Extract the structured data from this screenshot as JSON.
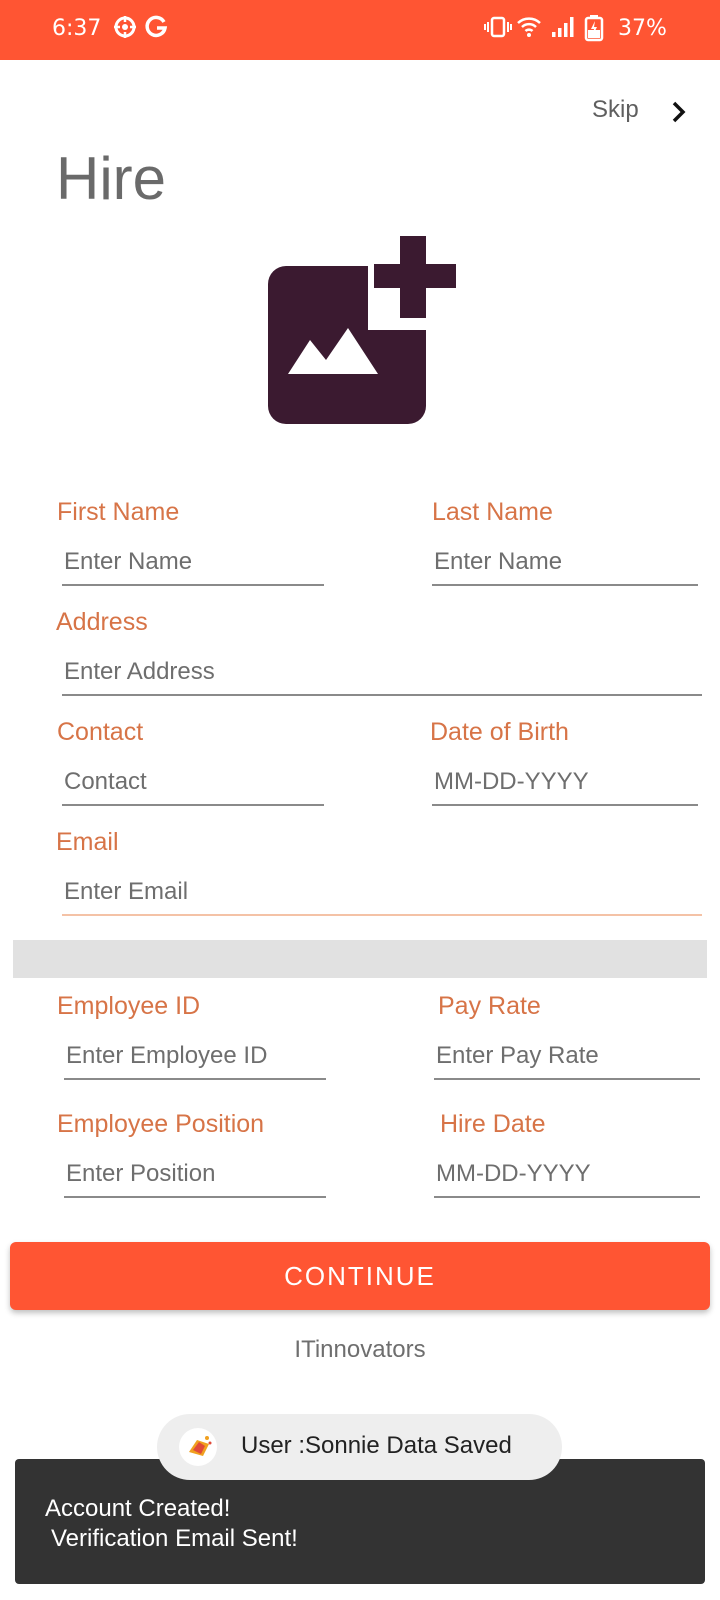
{
  "status_bar": {
    "time": "6:37",
    "battery": "37%",
    "icons": [
      "sync-icon",
      "google-icon",
      "vibrate-icon",
      "wifi-icon",
      "signal-icon",
      "battery-icon"
    ]
  },
  "header": {
    "skip_label": "Skip",
    "title": "Hire"
  },
  "photo": {
    "icon": "add-photo-icon",
    "color": "#3b1a30"
  },
  "form": {
    "first_name": {
      "label": "First Name",
      "placeholder": "Enter Name"
    },
    "last_name": {
      "label": "Last Name",
      "placeholder": "Enter Name"
    },
    "address": {
      "label": "Address",
      "placeholder": "Enter Address"
    },
    "contact": {
      "label": "Contact",
      "placeholder": "Contact"
    },
    "dob": {
      "label": "Date of Birth",
      "placeholder": "MM-DD-YYYY"
    },
    "email": {
      "label": "Email",
      "placeholder": "Enter Email"
    },
    "employee_id": {
      "label": "Employee ID",
      "placeholder": "Enter Employee ID"
    },
    "pay_rate": {
      "label": "Pay Rate",
      "placeholder": "Enter Pay Rate"
    },
    "position": {
      "label": "Employee Position",
      "placeholder": "Enter Position"
    },
    "hire_date": {
      "label": "Hire Date",
      "placeholder": "MM-DD-YYYY"
    }
  },
  "actions": {
    "continue_label": "CONTINUE"
  },
  "footer": {
    "brand": "ITinnovators"
  },
  "toast": {
    "text": "User :Sonnie Data Saved"
  },
  "snackbar": {
    "line1": "Account Created!",
    "line2": "Verification Email Sent!"
  },
  "colors": {
    "accent": "#ff5533",
    "label": "#d77447",
    "icon": "#3b1a30"
  }
}
